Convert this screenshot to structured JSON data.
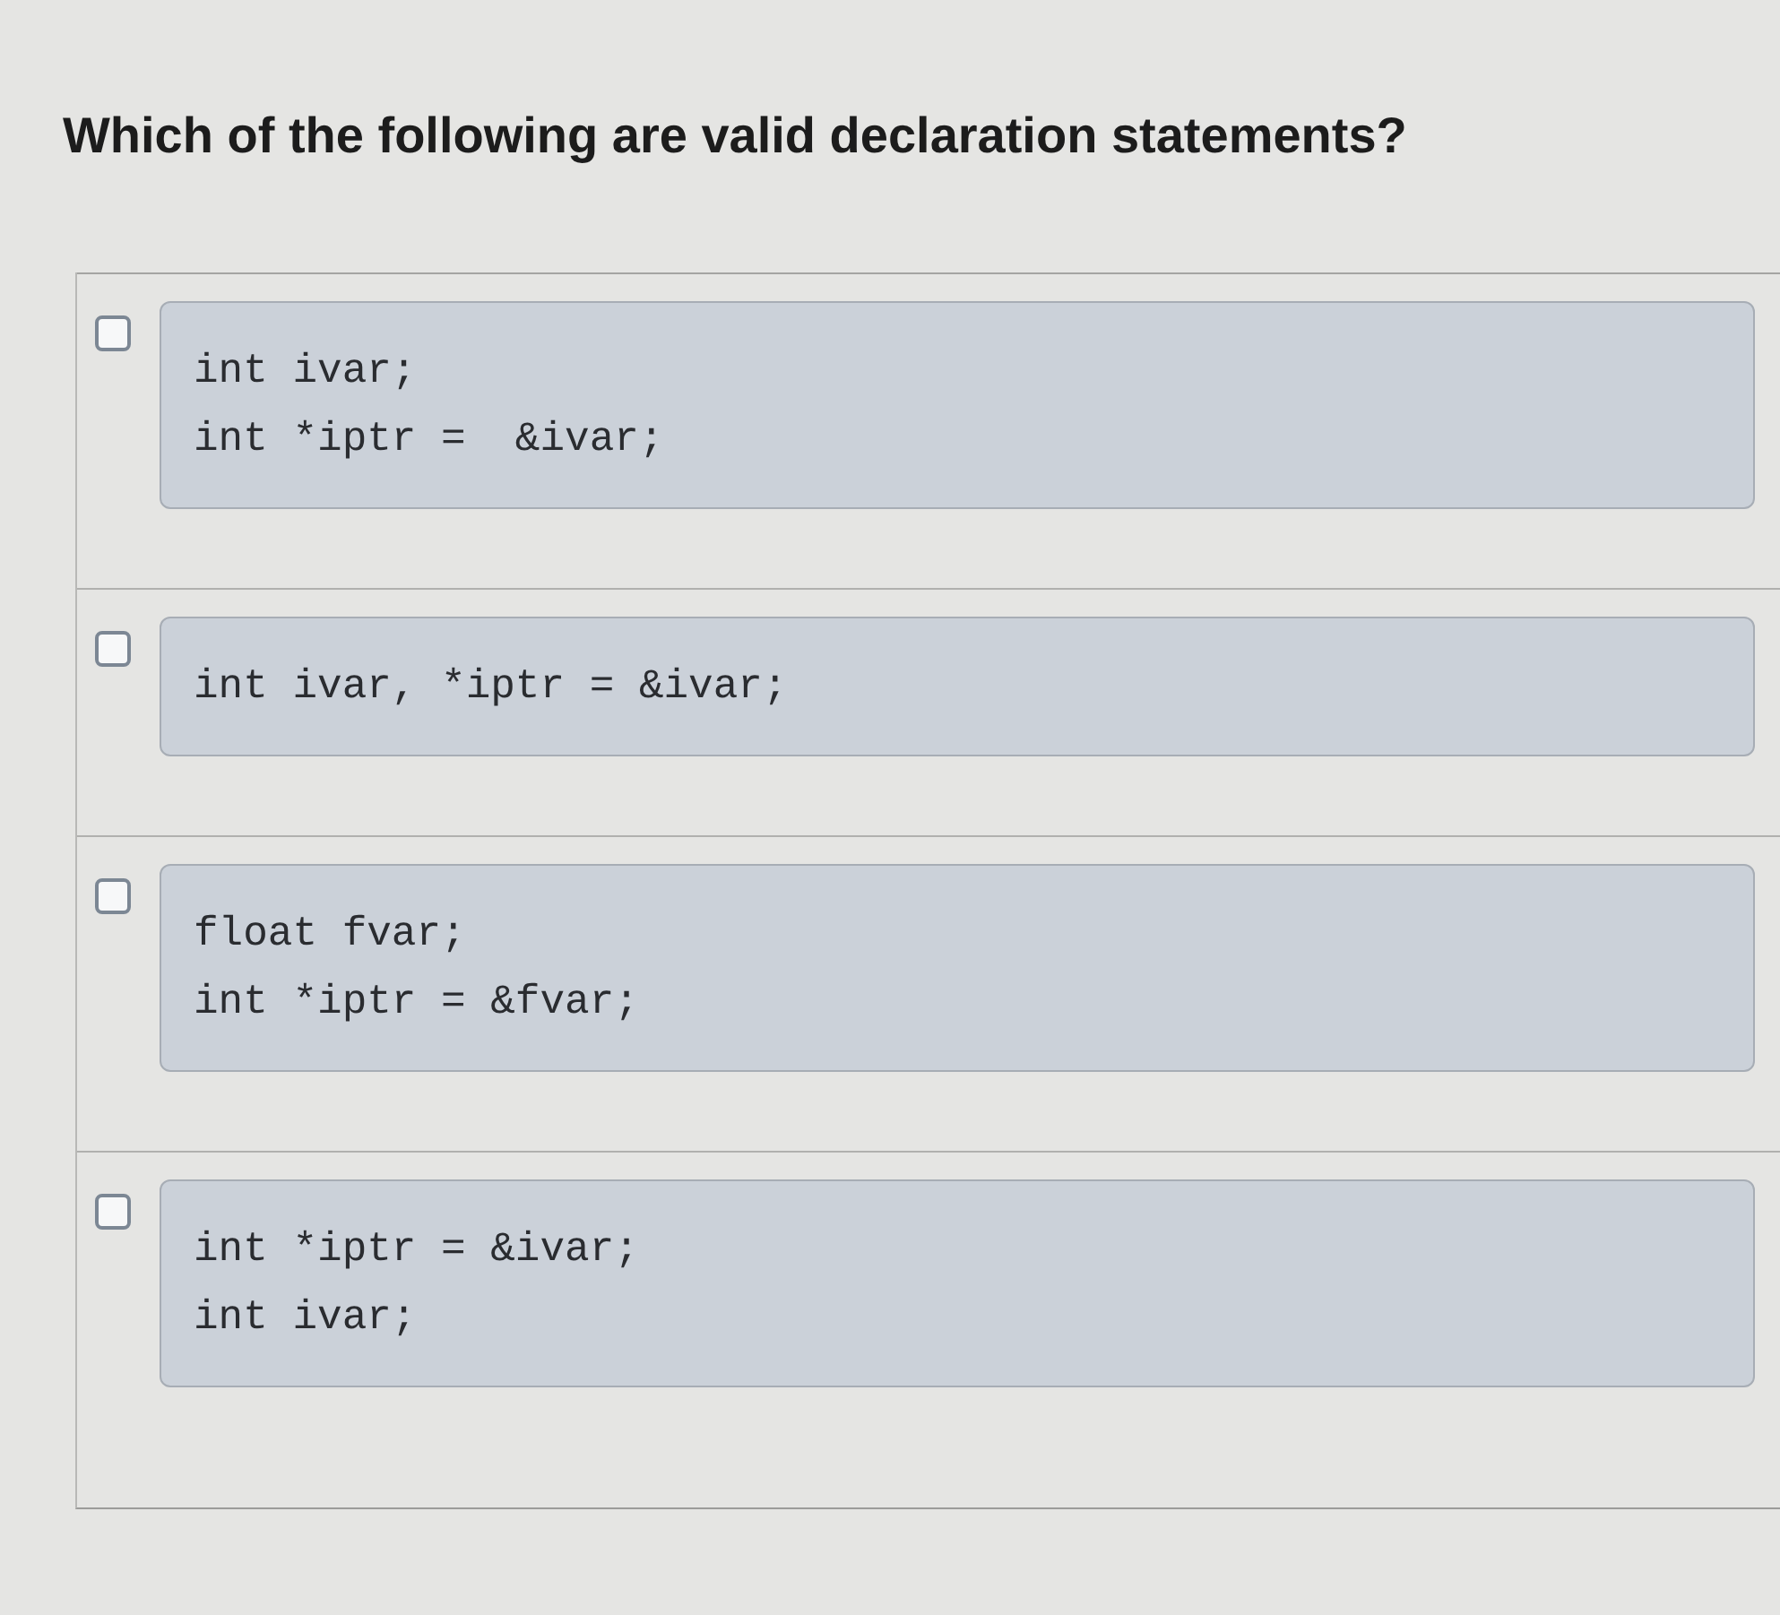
{
  "question": {
    "text": "Which of the following are valid declaration statements?"
  },
  "options": [
    {
      "checked": false,
      "lines": [
        "int ivar;",
        "int *iptr =  &ivar;"
      ]
    },
    {
      "checked": false,
      "lines": [
        "int ivar, *iptr = &ivar;"
      ]
    },
    {
      "checked": false,
      "lines": [
        "float fvar;",
        "int *iptr = &fvar;"
      ]
    },
    {
      "checked": false,
      "lines": [
        "int *iptr = &ivar;",
        "int ivar;"
      ]
    }
  ]
}
